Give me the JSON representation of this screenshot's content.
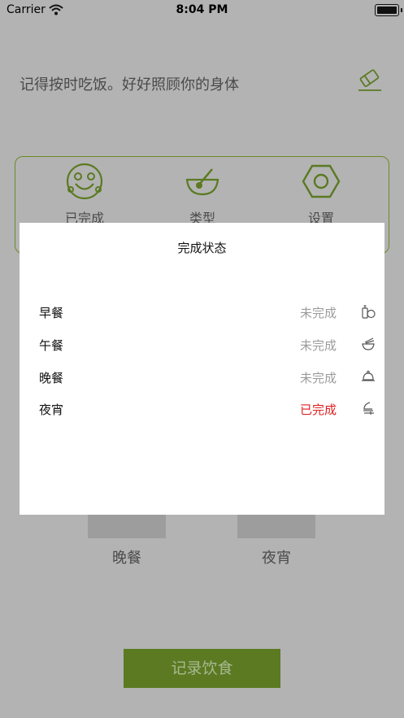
{
  "status_bar": {
    "carrier": "Carrier",
    "time": "8:04 PM"
  },
  "header": {
    "message": "记得按时吃饭。好好照顾你的身体"
  },
  "panel": {
    "items": [
      {
        "label": "已完成",
        "icon": "smiley-face-icon"
      },
      {
        "label": "类型",
        "icon": "bowl-spoon-icon"
      },
      {
        "label": "设置",
        "icon": "hex-nut-icon"
      }
    ]
  },
  "meals_background": {
    "dinner_label": "晚餐",
    "night_snack_label": "夜宵"
  },
  "record_button": {
    "label": "记录饮食"
  },
  "modal": {
    "title": "完成状态",
    "rows": [
      {
        "name": "早餐",
        "status": "未完成",
        "status_color": "#9b9b9b",
        "icon": "bread-bottle-icon"
      },
      {
        "name": "午餐",
        "status": "未完成",
        "status_color": "#9b9b9b",
        "icon": "noodle-bowl-icon"
      },
      {
        "name": "晚餐",
        "status": "未完成",
        "status_color": "#9b9b9b",
        "icon": "cloche-icon"
      },
      {
        "name": "夜宵",
        "status": "已完成",
        "status_color": "#e02020",
        "icon": "moon-fork-icon"
      }
    ]
  },
  "colors": {
    "accent": "#5b7a22",
    "overlay": "#b3b3b3",
    "completed": "#e02020",
    "pending": "#9b9b9b"
  }
}
